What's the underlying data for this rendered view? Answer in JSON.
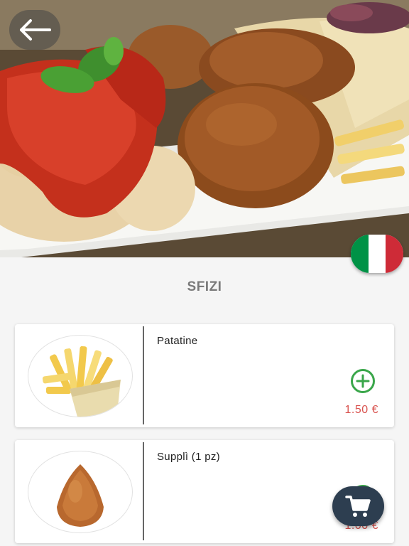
{
  "header": {
    "back_icon": "arrow-left-icon",
    "language_flag": "italy-flag-icon"
  },
  "section": {
    "title": "SFIZI"
  },
  "items": [
    {
      "name": "Patatine",
      "price": "1.50 €",
      "image": "fries-image",
      "add_icon": "plus-circle-icon"
    },
    {
      "name": "Supplì (1 pz)",
      "price": "1.00 €",
      "image": "suppli-image",
      "add_icon": "plus-circle-icon"
    }
  ],
  "cart": {
    "icon": "cart-icon"
  },
  "colors": {
    "section_title": "#7a7a7a",
    "price": "#d9534f",
    "add_icon": "#3aa64a",
    "cart_fab": "#2d3e50",
    "flag_green": "#009246",
    "flag_white": "#ffffff",
    "flag_red": "#ce2b37"
  }
}
